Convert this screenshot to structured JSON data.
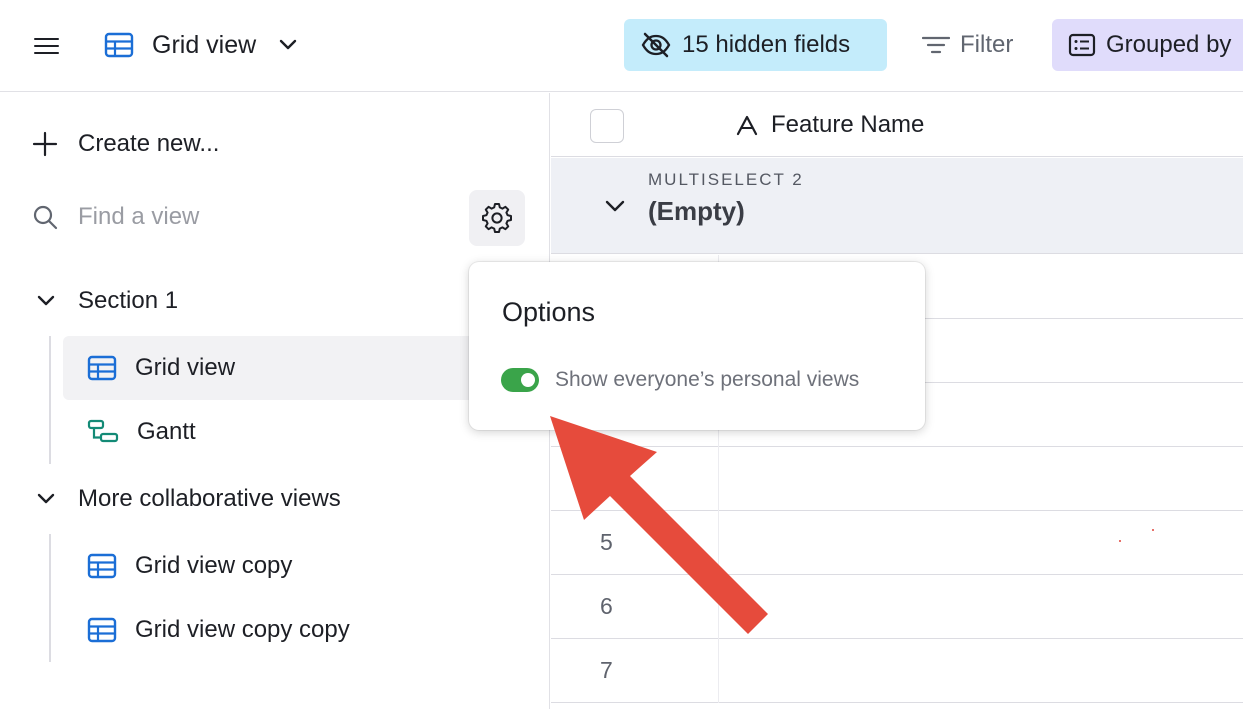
{
  "topbar": {
    "view_title": "Grid view",
    "hidden_fields_label": "15 hidden fields",
    "filter_label": "Filter",
    "grouped_label": "Grouped by"
  },
  "sidebar": {
    "create_new_label": "Create new...",
    "find_placeholder": "Find a view",
    "sections": [
      {
        "label": "Section 1",
        "items": [
          {
            "label": "Grid view",
            "icon": "grid-icon",
            "active": true
          },
          {
            "label": "Gantt",
            "icon": "gantt-icon",
            "active": false
          }
        ]
      },
      {
        "label": "More collaborative views",
        "items": [
          {
            "label": "Grid view copy",
            "icon": "grid-icon",
            "active": false
          },
          {
            "label": "Grid view copy copy",
            "icon": "grid-icon",
            "active": false
          }
        ]
      }
    ]
  },
  "grid": {
    "column_header": "Feature Name",
    "group_kicker": "MULTISELECT 2",
    "group_value": "(Empty)",
    "rows": [
      {
        "number": ""
      },
      {
        "number": ""
      },
      {
        "number": ""
      },
      {
        "number": ""
      },
      {
        "number": "5"
      },
      {
        "number": "6"
      },
      {
        "number": "7"
      }
    ]
  },
  "options_popover": {
    "title": "Options",
    "toggle_label": "Show everyone’s personal views",
    "toggle_on": true
  },
  "colors": {
    "accent_blue": "#1b6ed6",
    "gantt_teal": "#138a76",
    "hidden_fields_bg": "#c4ecfb",
    "grouped_bg": "#e0dcfb",
    "toggle_on": "#3aa44a",
    "annotation_arrow": "#e64b3c"
  }
}
